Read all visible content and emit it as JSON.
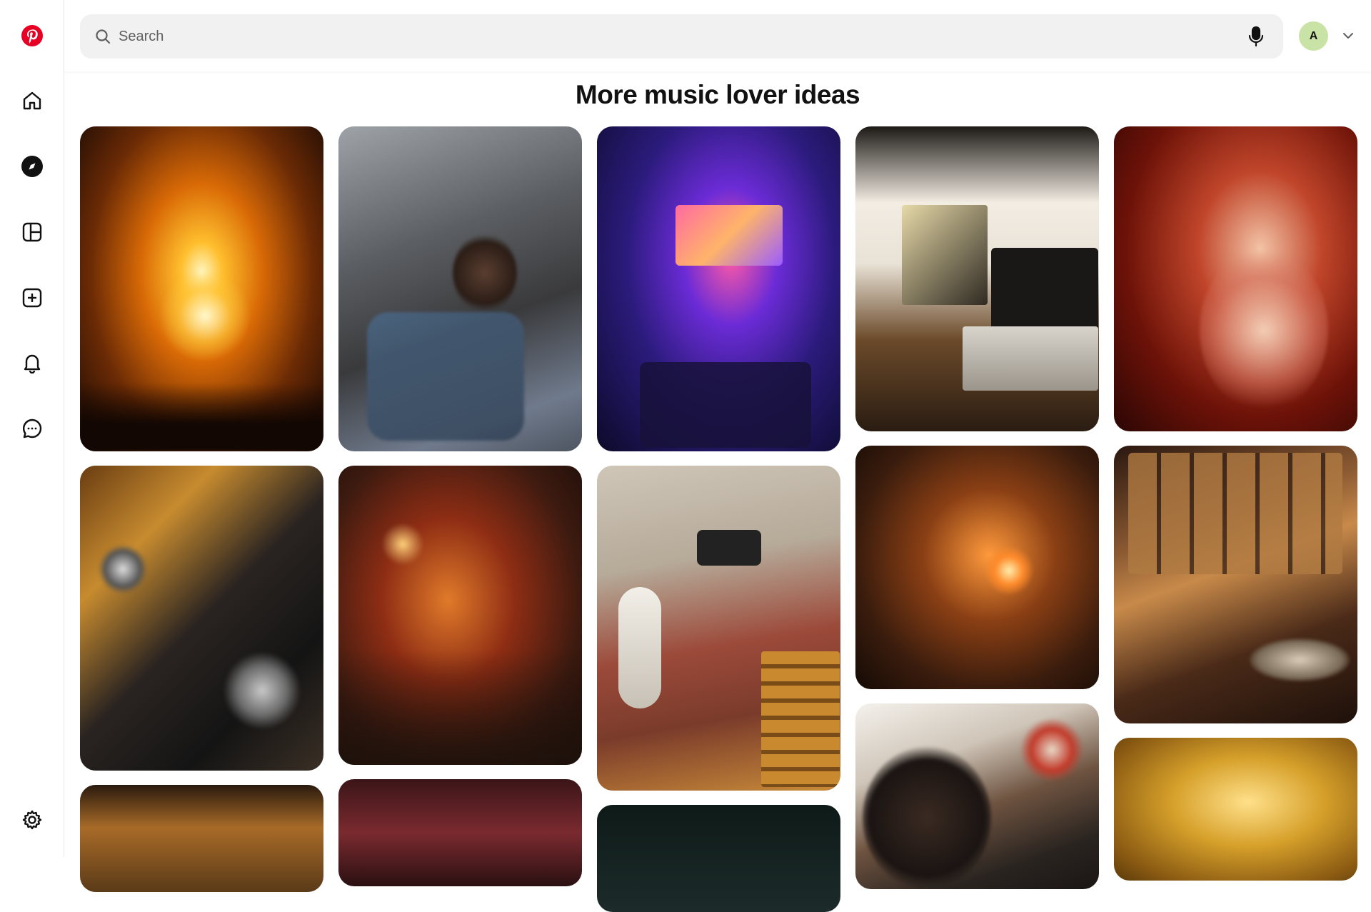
{
  "app": {
    "name": "Pinterest",
    "brand_color": "#e60023"
  },
  "sidebar": {
    "items": [
      {
        "name": "pinterest-logo",
        "icon": "pinterest-logo-icon"
      },
      {
        "name": "home",
        "icon": "home-icon"
      },
      {
        "name": "explore",
        "icon": "compass-icon",
        "active": true
      },
      {
        "name": "boards",
        "icon": "boards-icon"
      },
      {
        "name": "create",
        "icon": "plus-square-icon"
      },
      {
        "name": "notifications",
        "icon": "bell-icon"
      },
      {
        "name": "messages",
        "icon": "chat-icon"
      },
      {
        "name": "settings",
        "icon": "gear-icon"
      }
    ]
  },
  "search": {
    "placeholder": "Search",
    "value": ""
  },
  "account": {
    "avatar_initial": "A",
    "avatar_color": "#c9e3a6"
  },
  "main": {
    "title": "More music lover ideas"
  },
  "pins": [
    {
      "column": 1,
      "description": "Concert stage with bright orange lights"
    },
    {
      "column": 2,
      "description": "Woman with headphones on a bus seat"
    },
    {
      "column": 3,
      "description": "Purple party room with TV and dancer"
    },
    {
      "column": 4,
      "description": "Record player by a window with candle"
    },
    {
      "column": 5,
      "description": "Singer with microphone in red light"
    },
    {
      "column": 1,
      "description": "DJ hands on turntable controller"
    },
    {
      "column": 2,
      "description": "Crowded bar with warm lights"
    },
    {
      "column": 3,
      "description": "Person lying on rug with guitar"
    },
    {
      "column": 4,
      "description": "People playing guitar by fireplace"
    },
    {
      "column": 5,
      "description": "Vinyl record bar with shelves"
    },
    {
      "column": 1,
      "description": "Warm golden lit interior"
    },
    {
      "column": 2,
      "description": "Pub ceiling with signs"
    },
    {
      "column": 3,
      "description": "Dark night scene"
    },
    {
      "column": 4,
      "description": "Drummer with headphones in studio"
    },
    {
      "column": 5,
      "description": "Yellow room with hanging plant"
    }
  ]
}
